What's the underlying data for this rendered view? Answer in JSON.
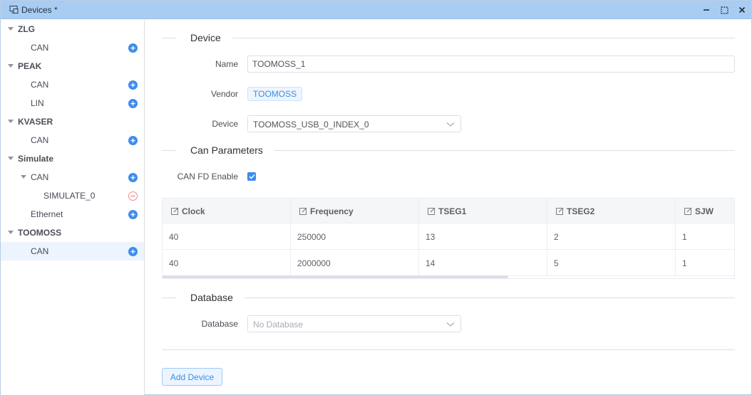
{
  "window": {
    "title": "Devices *",
    "icon": "devices-icon",
    "controls": [
      "minimize-icon",
      "maximize-icon",
      "close-icon"
    ]
  },
  "sidebar": {
    "groups": [
      {
        "name": "ZLG",
        "children": [
          {
            "name": "CAN",
            "action": "add"
          }
        ]
      },
      {
        "name": "PEAK",
        "children": [
          {
            "name": "CAN",
            "action": "add"
          },
          {
            "name": "LIN",
            "action": "add"
          }
        ]
      },
      {
        "name": "KVASER",
        "children": [
          {
            "name": "CAN",
            "action": "add"
          }
        ]
      },
      {
        "name": "Simulate",
        "children": [
          {
            "name": "CAN",
            "action": "add",
            "expanded": true,
            "children": [
              {
                "name": "SIMULATE_0",
                "action": "remove"
              }
            ]
          },
          {
            "name": "Ethernet",
            "action": "add"
          }
        ]
      },
      {
        "name": "TOOMOSS",
        "children": [
          {
            "name": "CAN",
            "action": "add",
            "selected": true
          }
        ]
      }
    ]
  },
  "form": {
    "device_section": "Device",
    "name_label": "Name",
    "name_value": "TOOMOSS_1",
    "vendor_label": "Vendor",
    "vendor_value": "TOOMOSS",
    "device_label": "Device",
    "device_value": "TOOMOSS_USB_0_INDEX_0",
    "can_section": "Can Parameters",
    "canfd_label": "CAN FD Enable",
    "canfd_checked": true,
    "database_section": "Database",
    "database_label": "Database",
    "database_placeholder": "No Database",
    "add_button": "Add Device"
  },
  "table": {
    "columns": [
      "Clock",
      "Frequency",
      "TSEG1",
      "TSEG2",
      "SJW"
    ],
    "rows": [
      [
        "40",
        "250000",
        "13",
        "2",
        "1"
      ],
      [
        "40",
        "2000000",
        "14",
        "5",
        "1"
      ]
    ]
  },
  "colors": {
    "accent": "#3c8cee",
    "titlebar": "#a9cdf2",
    "selected_row": "#ecf4fd",
    "remove": "#f28a8a"
  }
}
